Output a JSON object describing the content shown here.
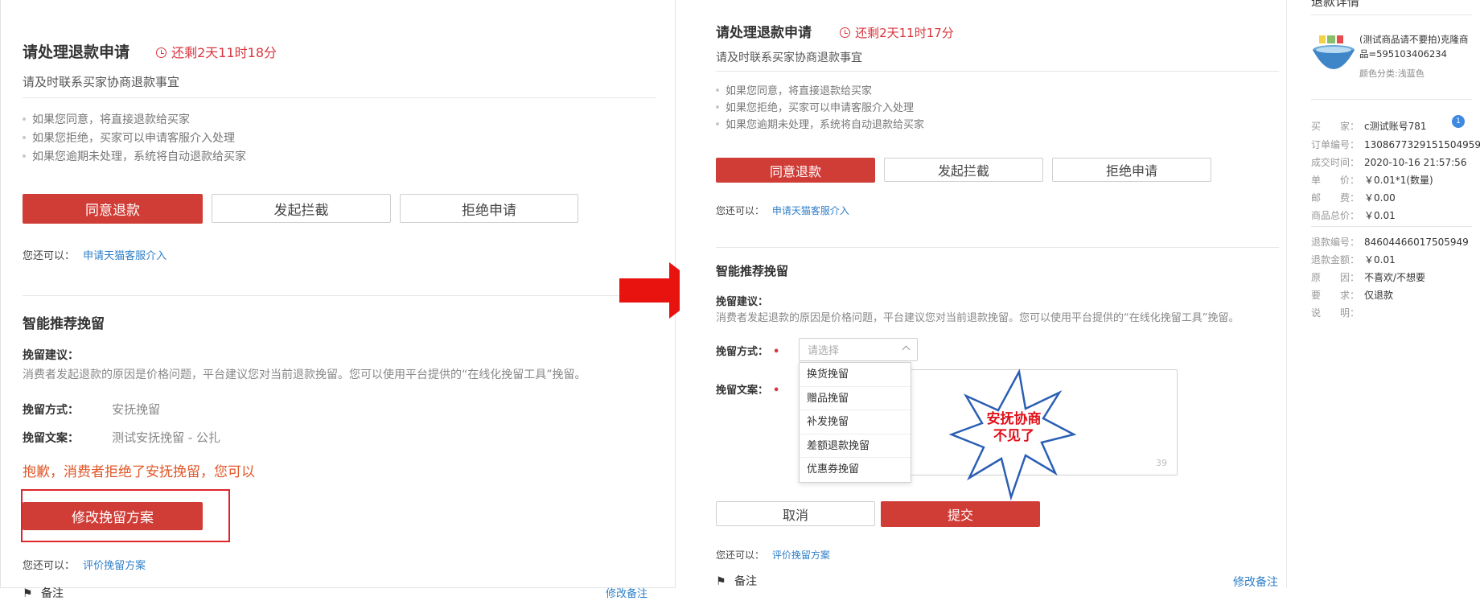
{
  "left": {
    "title": "请处理退款申请",
    "timer": "还剩2天11时18分",
    "subtitle": "请及时联系买家协商退款事宜",
    "bullets": [
      "如果您同意，将直接退款给买家",
      "如果您拒绝，买家可以申请客服介入处理",
      "如果您逾期未处理，系统将自动退款给买家"
    ],
    "buttons": {
      "agree": "同意退款",
      "intercept": "发起拦截",
      "reject": "拒绝申请"
    },
    "also_label": "您还可以：",
    "also_link": "申请天猫客服介入",
    "section_title": "智能推荐挽留",
    "advice_label": "挽留建议：",
    "advice_text": "消费者发起退款的原因是价格问题，平台建议您对当前退款挽留。您可以使用平台提供的“在线化挽留工具”挽留。",
    "method_label": "挽留方式：",
    "method_value": "安抚挽留",
    "copy_label": "挽留文案：",
    "copy_value": "测试安抚挽留 - 公扎",
    "warning": "抱歉，消费者拒绝了安抚挽留，您可以",
    "modify_button": "修改挽留方案",
    "also_label2": "您还可以：",
    "also_link2": "评价挽留方案",
    "remark": "备注",
    "modify_remark": "修改备注"
  },
  "mid": {
    "title": "请处理退款申请",
    "timer": "还剩2天11时17分",
    "subtitle": "请及时联系买家协商退款事宜",
    "bullets": [
      "如果您同意，将直接退款给买家",
      "如果您拒绝，买家可以申请客服介入处理",
      "如果您逾期未处理，系统将自动退款给买家"
    ],
    "buttons": {
      "agree": "同意退款",
      "intercept": "发起拦截",
      "reject": "拒绝申请"
    },
    "also_label": "您还可以：",
    "also_link": "申请天猫客服介入",
    "section_title": "智能推荐挽留",
    "advice_label": "挽留建议：",
    "advice_text": "消费者发起退款的原因是价格问题，平台建议您对当前退款挽留。您可以使用平台提供的“在线化挽留工具”挽留。",
    "method_label": "挽留方式：",
    "method_placeholder": "请选择",
    "copy_label": "挽留文案：",
    "dropdown_options": [
      "换货挽留",
      "赠品挽留",
      "补发挽留",
      "差额退款挽留",
      "优惠券挽留"
    ],
    "char_count": "39",
    "callout": [
      "安抚协商",
      "不见了"
    ],
    "cancel": "取消",
    "submit": "提交",
    "also_label2": "您还可以：",
    "also_link2": "评价挽留方案",
    "remark": "备注",
    "modify_remark": "修改备注"
  },
  "right": {
    "header_partial": "退款详情",
    "product_name": "(测试商品请不要拍)克隆商品=595103406234",
    "product_attr": "颜色分类:浅蓝色",
    "badge": "1",
    "rows_order": [
      {
        "k": "买　　家：",
        "v": "c测试账号781"
      },
      {
        "k": "订单编号：",
        "v": "1308677329151504959"
      },
      {
        "k": "成交时间：",
        "v": "2020-10-16 21:57:56"
      },
      {
        "k": "单　　价：",
        "v": "￥0.01*1(数量)"
      },
      {
        "k": "邮　　费：",
        "v": "￥0.00"
      },
      {
        "k": "商品总价：",
        "v": "￥0.01"
      }
    ],
    "rows_refund": [
      {
        "k": "退款编号：",
        "v": "84604466017505949"
      },
      {
        "k": "退款金额：",
        "v": "￥0.01"
      },
      {
        "k": "原　　因：",
        "v": "不喜欢/不想要"
      },
      {
        "k": "要　　求：",
        "v": "仅退款"
      },
      {
        "k": "说　　明：",
        "v": ""
      }
    ]
  },
  "colors": {
    "primary_red": "#d03d37",
    "link_blue": "#2f7fc8",
    "warning_orange": "#e0582a",
    "arrow_red": "#e8130f"
  }
}
